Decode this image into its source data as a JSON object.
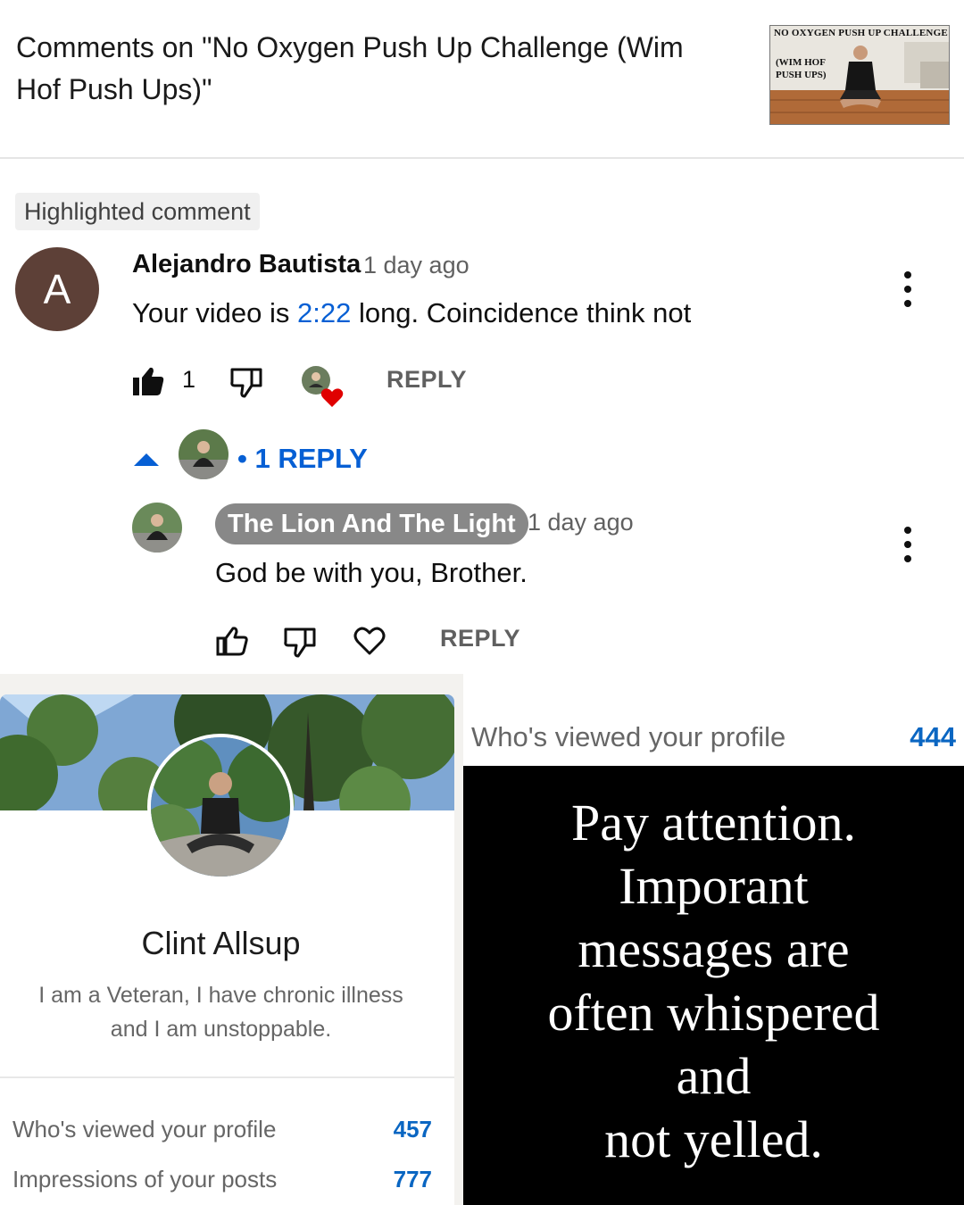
{
  "youtube": {
    "title": "Comments on \"No Oxygen Push Up Challenge (Wim Hof Push Ups)\"",
    "thumbnail": {
      "caption_top": "NO OXYGEN PUSH UP CHALLENGE",
      "caption_line1": "(WIM HOF",
      "caption_line2": "PUSH UPS)"
    },
    "highlighted_label": "Highlighted comment",
    "comment": {
      "avatar_letter": "A",
      "author": "Alejandro Bautista",
      "time": "1 day ago",
      "text_before": "Your video is ",
      "text_link": "2:22",
      "text_after": " long. Coincidence think not",
      "like_count": "1",
      "reply_label": "REPLY"
    },
    "replies_toggle": {
      "label": "• 1 REPLY"
    },
    "reply": {
      "author": "The Lion And The Light",
      "time": "1 day ago",
      "text": "God be with you, Brother.",
      "reply_label": "REPLY"
    }
  },
  "linkedin": {
    "name": "Clint Allsup",
    "headline_line1": "I am a Veteran, I have chronic illness",
    "headline_line2": "and I am unstoppable.",
    "stats": [
      {
        "label": "Who's viewed your profile",
        "value": "457"
      },
      {
        "label": "Impressions of your posts",
        "value": "777"
      }
    ]
  },
  "right_panel": {
    "viewed_label": "Who's viewed your profile",
    "viewed_value": "444"
  },
  "quote": {
    "lines": [
      "Pay attention.",
      "Imporant",
      "messages are",
      "often whispered",
      "and",
      "not yelled."
    ]
  },
  "colors": {
    "link_blue": "#065fd4",
    "linkedin_blue": "#0a66c2",
    "avatar_brown": "#5d4037",
    "heart_red": "#e00000"
  }
}
